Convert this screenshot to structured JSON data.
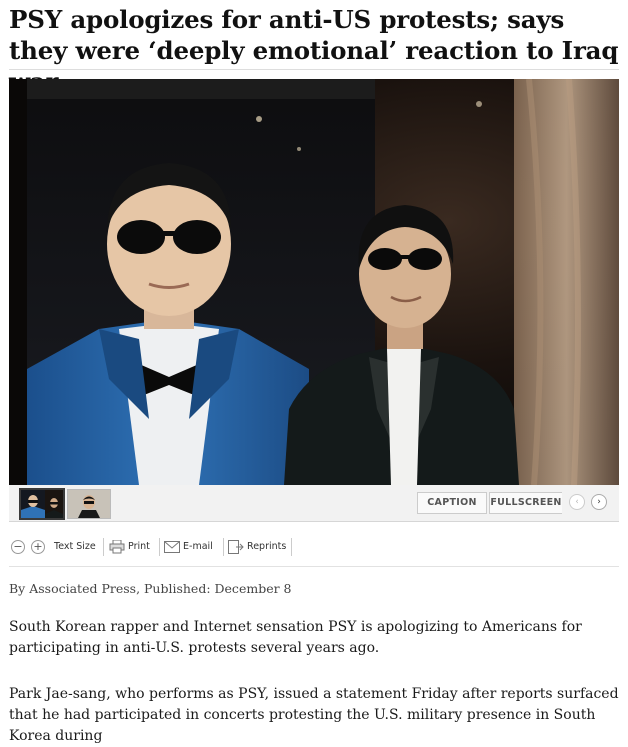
{
  "article": {
    "headline": "PSY apologizes for anti-US protests; says they were ‘deeply emotional’ reaction to Iraq war",
    "byline": "By Associated Press, Published: December 8",
    "paragraphs": [
      "South Korean rapper and Internet sensation PSY is apologizing to Americans for participating in anti-U.S. protests several years ago.",
      "Park Jae-sang, who performs as PSY, issued a statement Friday after reports surfaced that he had participated in concerts protesting the U.S. military presence in South Korea during"
    ]
  },
  "gallery": {
    "caption_label": "CAPTION",
    "fullscreen_label": "FULLSCREEN",
    "prev_glyph": "‹",
    "next_glyph": "›"
  },
  "toolbar": {
    "decrease_glyph": "−",
    "increase_glyph": "+",
    "text_size_label": "Text Size",
    "print_label": "Print",
    "email_label": "E-mail",
    "reprints_label": "Reprints"
  },
  "colors": {
    "headline": "#111111",
    "body_text": "#1a1a1a",
    "divider": "#dddddd",
    "blue_jacket": "#2f6fb0"
  },
  "icons": [
    "printer-icon",
    "envelope-icon",
    "reprints-icon"
  ]
}
